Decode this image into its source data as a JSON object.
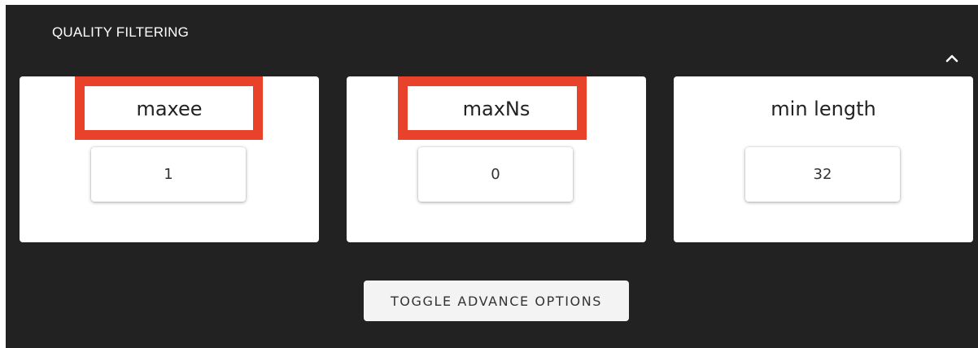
{
  "section": {
    "title": "QUALITY FILTERING",
    "collapse_icon": "chevron-up-icon"
  },
  "fields": [
    {
      "label": "maxee",
      "value": "1",
      "highlighted": true
    },
    {
      "label": "maxNs",
      "value": "0",
      "highlighted": true
    },
    {
      "label": "min length",
      "value": "32",
      "highlighted": false
    }
  ],
  "toggle_button": {
    "label": "TOGGLE ADVANCE OPTIONS"
  },
  "colors": {
    "panel_background": "#222222",
    "card_background": "#ffffff",
    "highlight_border": "#e8432a",
    "button_background": "#f3f3f3"
  }
}
